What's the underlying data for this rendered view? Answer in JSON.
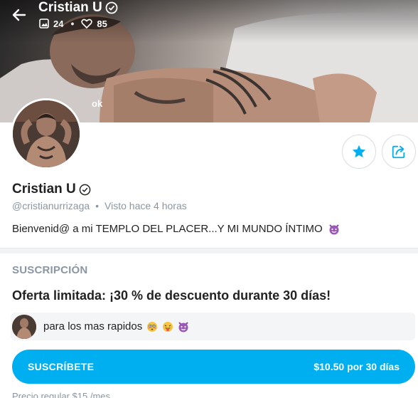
{
  "header": {
    "name": "Cristian U",
    "photos_count": "24",
    "likes_count": "85",
    "stats_separator": "•",
    "cover_text": "ok"
  },
  "profile": {
    "name": "Cristian U",
    "username": "@cristianurrizaga",
    "separator": "•",
    "last_seen": "Visto  hace 4 horas",
    "bio": "Bienvenid@ a mi TEMPLO DEL PLACER...Y MI MUNDO ÍNTIMO"
  },
  "subscription": {
    "section_title": "SUSCRIPCIÓN",
    "offer": "Oferta limitada: ¡30 % de descuento durante 30 días!",
    "promo_message": "para los mas rapidos",
    "button_label": "SUSCRÍBETE",
    "button_price": "$10.50 por 30 días",
    "regular_price": "Precio regular $15 /mes"
  },
  "colors": {
    "accent": "#00aff0",
    "muted": "#8a96a3"
  },
  "icons": [
    "back-arrow-icon",
    "verified-icon",
    "image-icon",
    "heart-icon",
    "star-icon",
    "share-icon",
    "devil-emoji-icon",
    "flushed-emoji-icon",
    "tongue-emoji-icon"
  ]
}
